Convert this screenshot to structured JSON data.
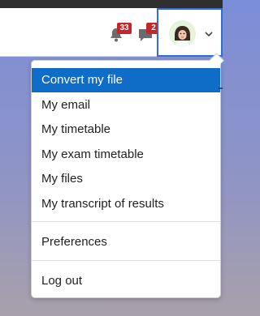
{
  "header": {
    "notifications": {
      "icon": "bell-icon",
      "count": "33"
    },
    "messages": {
      "icon": "chat-bubble-icon",
      "count": "2"
    },
    "user_menu": {
      "avatar": "user-avatar",
      "toggle_icon": "chevron-down-icon"
    }
  },
  "menu": {
    "items": [
      {
        "label": "Convert my file",
        "active": true
      },
      {
        "label": "My email"
      },
      {
        "label": "My timetable"
      },
      {
        "label": "My exam timetable"
      },
      {
        "label": "My files"
      },
      {
        "label": "My transcript of results"
      },
      {
        "label": "Preferences"
      },
      {
        "label": "Log out"
      }
    ]
  },
  "colors": {
    "active_item": "#0f6cc7",
    "badge": "#c4262e",
    "focus_border": "#2f6fd0"
  }
}
